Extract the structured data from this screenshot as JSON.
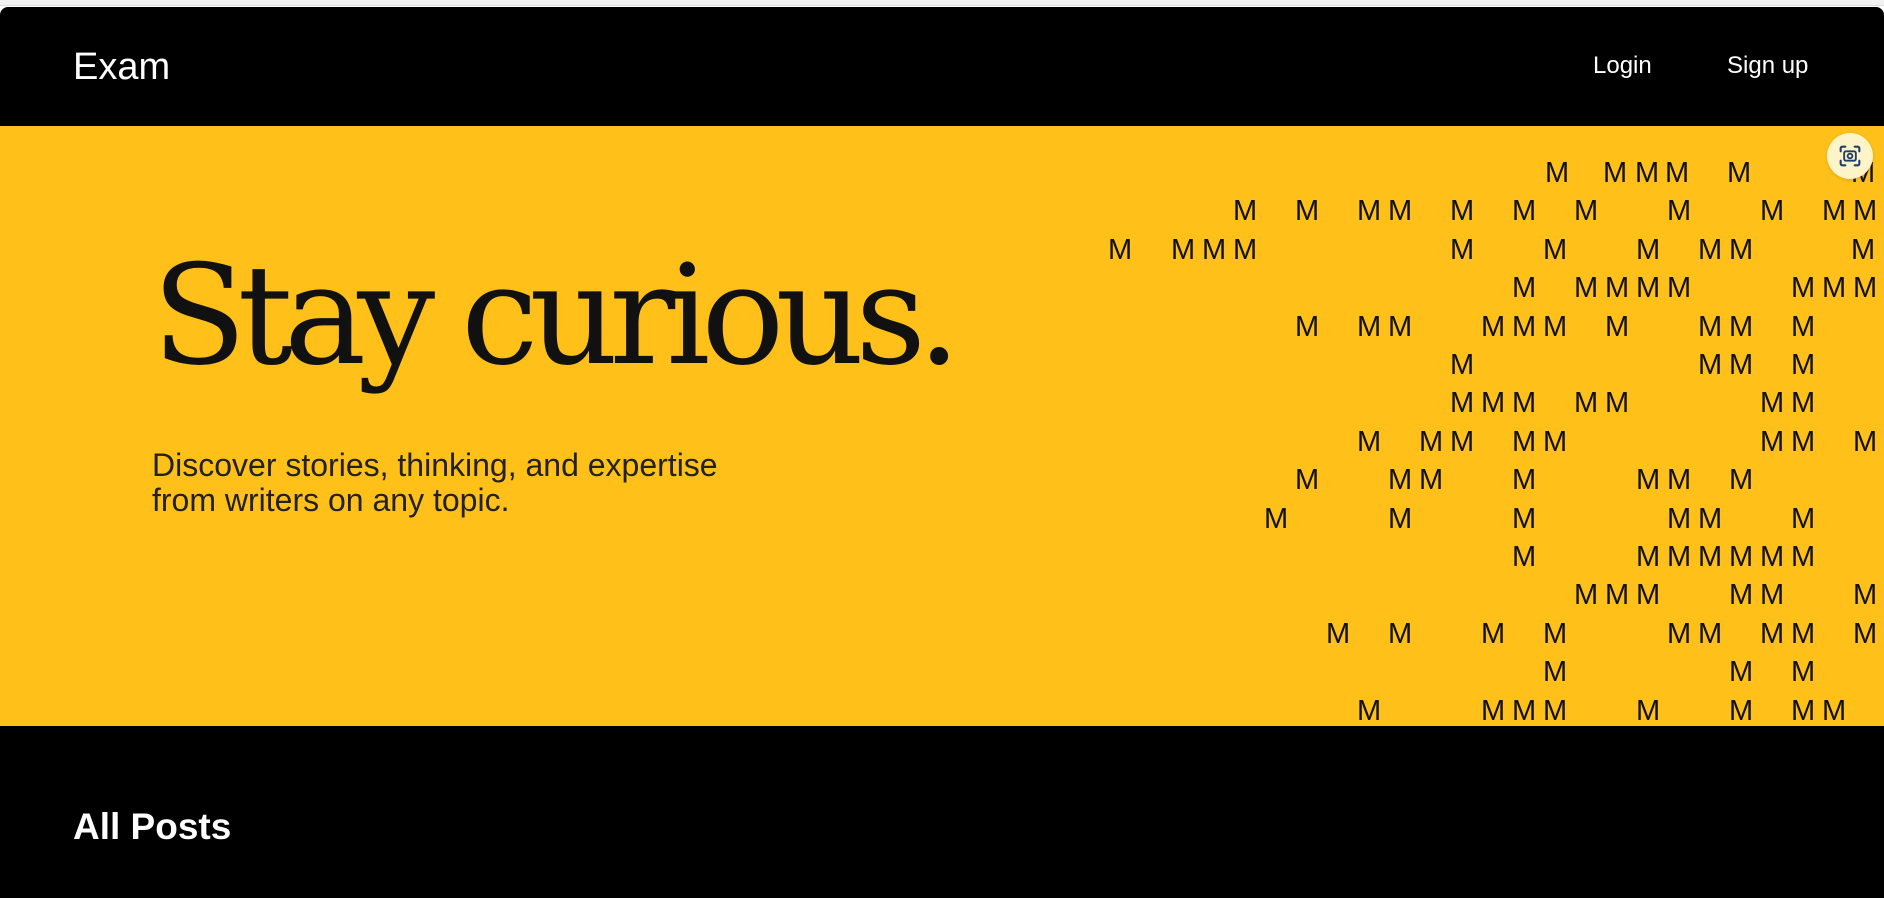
{
  "navbar": {
    "brand": "Exam",
    "login_label": "Login",
    "signup_label": "Sign up"
  },
  "hero": {
    "title": "Stay curious.",
    "subtitle": "Discover stories, thinking, and expertise from writers on any topic.",
    "background_color": "#ffc01a",
    "pattern_letter": "M"
  },
  "lens_button": {
    "icon": "lens-scan-icon"
  },
  "posts": {
    "heading": "All Posts"
  },
  "colors": {
    "nav_background": "#000000",
    "hero_background": "#ffc01a",
    "text_dark": "#111111",
    "text_light": "#ffffff"
  }
}
